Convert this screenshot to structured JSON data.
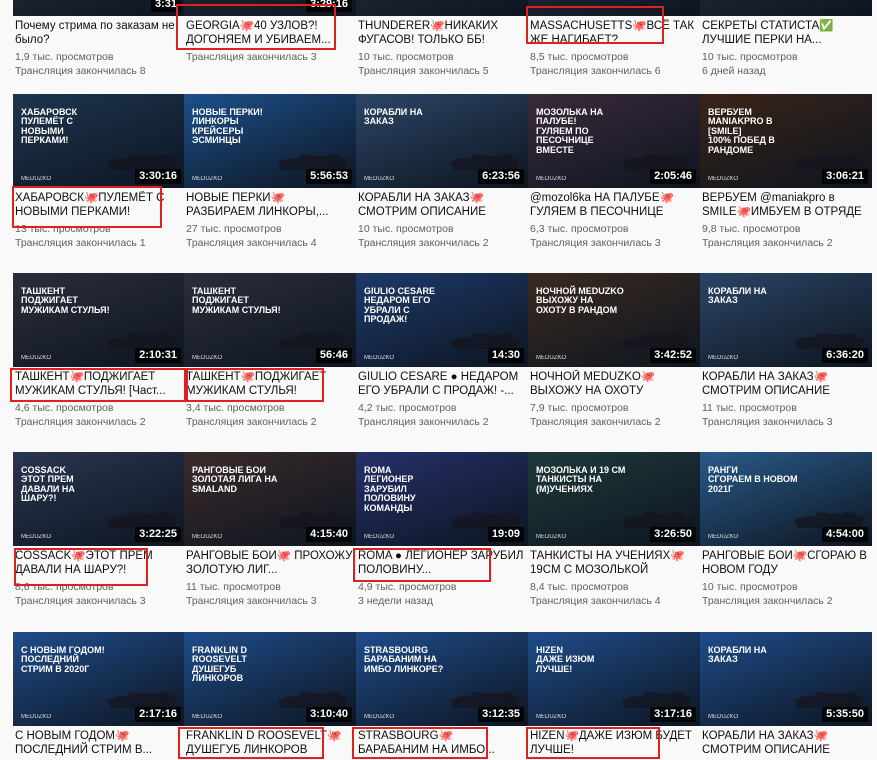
{
  "colors": {
    "highlight": "#e02020",
    "meta_text": "#606060",
    "duration_bg": "#000000"
  },
  "rows": [
    [
      {
        "title": "Почему стрима по заказам не было?",
        "views": "1,9 тыс. просмотров",
        "date": "Трансляция закончилась 8",
        "duration": "",
        "thumb_text": "",
        "thumb_color": "#2a3040"
      },
      {
        "title": "GEORGIA🐙40 УЗЛОВ?! ДОГОНЯЕМ И УБИВАЕМ...",
        "views": "",
        "date": "Трансляция закончилась 3",
        "duration": "",
        "thumb_text": "",
        "thumb_color": "#2a3040"
      },
      {
        "title": "THUNDERER🐙НИКАКИХ ФУГАСОВ! ТОЛЬКО ББ!",
        "views": "10 тыс. просмотров",
        "date": "Трансляция закончилась 5",
        "duration": "",
        "thumb_text": "",
        "thumb_color": "#2a3040"
      },
      {
        "title": "MASSACHUSETTS🐙ВСЁ ТАК ЖЕ НАГИБАЕТ?",
        "views": "8,5 тыс. просмотров",
        "date": "Трансляция закончилась 6",
        "duration": "",
        "thumb_text": "",
        "thumb_color": "#2a3040"
      },
      {
        "title": "СЕКРЕТЫ СТАТИСТА✅ ЛУЧШИЕ ПЕРКИ НА...",
        "views": "10 тыс. просмотров",
        "date": "6 дней назад",
        "duration": "",
        "thumb_text": "",
        "thumb_color": "#2a3040"
      }
    ],
    [
      {
        "title": "ХАБАРОВСК🐙ПУЛЕМЁТ С НОВЫМИ ПЕРКАМИ!",
        "views": "13 тыс. просмотров",
        "date": "Трансляция закончилась 1",
        "duration": "3:30:16",
        "thumb_text": "ХАБАРОВСК\nПУЛЕМЁТ С НОВЫМИ ПЕРКАМИ!",
        "thumb_color": "#1d3550"
      },
      {
        "title": "НОВЫЕ ПЕРКИ🐙 РАЗБИРАЕМ ЛИНКОРЫ,...",
        "views": "27 тыс. просмотров",
        "date": "Трансляция закончилась 4",
        "duration": "5:56:53",
        "thumb_text": "НОВЫЕ ПЕРКИ!\nЛИНКОРЫ КРЕЙСЕРЫ ЭСМИНЦЫ",
        "thumb_color": "#1c4f8a"
      },
      {
        "title": "КОРАБЛИ НА ЗАКАЗ🐙 СМОТРИМ ОПИСАНИЕ",
        "views": "10 тыс. просмотров",
        "date": "Трансляция закончилась 2",
        "duration": "6:23:56",
        "thumb_text": "КОРАБЛИ НА ЗАКАЗ",
        "thumb_color": "#2b4565"
      },
      {
        "title": "@mozol6ka НА ПАЛУБЕ🐙 ГУЛЯЕМ В ПЕСОЧНИЦЕ",
        "views": "6,3 тыс. просмотров",
        "date": "Трансляция закончилась 3",
        "duration": "2:05:46",
        "thumb_text": "МОЗОЛЬКА НА ПАЛУБЕ!\nГУЛЯЕМ ПО ПЕСОЧНИЦЕ ВМЕСТЕ",
        "thumb_color": "#3a2a3a"
      },
      {
        "title": "ВЕРБУЕМ @maniakpro в SMILE🐙ИМБУЕМ В ОТРЯДЕ",
        "views": "9,8 тыс. просмотров",
        "date": "Трансляция закончилась 2",
        "duration": "3:06:21",
        "thumb_text": "ВЕРБУЕМ MANIAKPRO В [SMILE]\n100% ПОБЕД В РАНДОМЕ",
        "thumb_color": "#3a2418"
      }
    ],
    [
      {
        "title": "ТАШКЕНТ🐙ПОДЖИГАЕТ МУЖИКАМ СТУЛЬЯ! [Част...",
        "views": "4,6 тыс. просмотров",
        "date": "Трансляция закончилась 2",
        "duration": "2:10:31",
        "thumb_text": "ТАШКЕНТ\nПОДЖИГАЕТ МУЖИКАМ СТУЛЬЯ!",
        "thumb_color": "#2a2e3a"
      },
      {
        "title": "ТАШКЕНТ🐙ПОДЖИГАЕТ МУЖИКАМ СТУЛЬЯ!",
        "views": "3,4 тыс. просмотров",
        "date": "Трансляция закончилась 2",
        "duration": "56:46",
        "thumb_text": "ТАШКЕНТ\nПОДЖИГАЕТ МУЖИКАМ СТУЛЬЯ!",
        "thumb_color": "#2a2e3a"
      },
      {
        "title": "GIULIO CESARE ● НЕДАРОМ ЕГО УБРАЛИ С ПРОДАЖ! -...",
        "views": "4,2 тыс. просмотров",
        "date": "Трансляция закончилась 2",
        "duration": "14:30",
        "thumb_text": "GIULIO CESARE\nНЕДАРОМ ЕГО УБРАЛИ С ПРОДАЖ!",
        "thumb_color": "#1d3a6a"
      },
      {
        "title": "НОЧНОЙ MEDUZKO🐙 ВЫХОЖУ НА ОХОТУ",
        "views": "7,9 тыс. просмотров",
        "date": "Трансляция закончилась 2",
        "duration": "3:42:52",
        "thumb_text": "НОЧНОЙ MEDUZKO\nВЫХОЖУ НА ОХОТУ В РАНДОМ",
        "thumb_color": "#3a2a20"
      },
      {
        "title": "КОРАБЛИ НА ЗАКАЗ🐙 СМОТРИМ ОПИСАНИЕ",
        "views": "11 тыс. просмотров",
        "date": "Трансляция закончилась 3",
        "duration": "6:36:20",
        "thumb_text": "КОРАБЛИ НА ЗАКАЗ",
        "thumb_color": "#2b4565"
      }
    ],
    [
      {
        "title": "COSSACK🐙ЭТОТ ПРЕМ ДАВАЛИ НА ШАРУ?!",
        "views": "8,6 тыс. просмотров",
        "date": "Трансляция закончилась 3",
        "duration": "3:22:25",
        "thumb_text": "COSSACK\nЭТОТ ПРЕМ ДАВАЛИ НА ШАРУ?!",
        "thumb_color": "#2a3550"
      },
      {
        "title": "РАНГОВЫЕ БОИ🐙 ПРОХОЖУ ЗОЛОТУЮ ЛИГ...",
        "views": "11 тыс. просмотров",
        "date": "Трансляция закончилась 3",
        "duration": "4:15:40",
        "thumb_text": "РАНГОВЫЕ БОИ\nЗОЛОТАЯ ЛИГА НА SMALAND",
        "thumb_color": "#3a2a2a"
      },
      {
        "title": "ROMA ● ЛЕГИОНЕР ЗАРУБИЛ ПОЛОВИНУ...",
        "views": "4,9 тыс. просмотров",
        "date": "3 недели назад",
        "duration": "19:09",
        "thumb_text": "ROMA\nЛЕГИОНЕР ЗАРУБИЛ ПОЛОВИНУ КОМАНДЫ",
        "thumb_color": "#26306a"
      },
      {
        "title": "ТАНКИСТЫ НА УЧЕНИЯХ🐙 19СМ С МОЗОЛЬКОЙ",
        "views": "8,4 тыс. просмотров",
        "date": "Трансляция закончилась 4",
        "duration": "3:26:50",
        "thumb_text": "МОЗОЛЬКА И 19 СМ\nТАНКИСТЫ НА (М)УЧЕНИЯХ",
        "thumb_color": "#1e3a3a"
      },
      {
        "title": "РАНГОВЫЕ БОИ🐙СГОРАЮ В НОВОМ ГОДУ",
        "views": "10 тыс. просмотров",
        "date": "Трансляция закончилась 2",
        "duration": "4:54:00",
        "thumb_text": "РАНГИ\nСГОРАЕМ В НОВОМ 2021Г",
        "thumb_color": "#2a5a8a"
      }
    ],
    [
      {
        "title": "С НОВЫМ ГОДОМ🐙 ПОСЛЕДНИЙ СТРИМ В...",
        "views": "",
        "date": "",
        "duration": "2:17:16",
        "thumb_text": "С НОВЫМ ГОДОМ!\nПОСЛЕДНИЙ СТРИМ В 2020Г",
        "thumb_color": "#1f4c8a"
      },
      {
        "title": "FRANKLIN D ROOSEVELT🐙 ДУШЕГУБ ЛИНКОРОВ",
        "views": "",
        "date": "",
        "duration": "3:10:40",
        "thumb_text": "FRANKLIN D ROOSEVELT\nДУШЕГУБ ЛИНКОРОВ",
        "thumb_color": "#1f4c8a"
      },
      {
        "title": "STRASBOURG🐙 БАРАБАНИМ НА ИМБО...",
        "views": "",
        "date": "",
        "duration": "3:12:35",
        "thumb_text": "STRASBOURG\nБАРАБАНИМ НА ИМБО ЛИНКОРЕ?",
        "thumb_color": "#1f4c8a"
      },
      {
        "title": "HIZEN🐙ДАЖЕ ИЗЮМ БУДЕТ ЛУЧШЕ!",
        "views": "",
        "date": "",
        "duration": "3:17:16",
        "thumb_text": "HIZEN\nДАЖЕ ИЗЮМ ЛУЧШЕ!",
        "thumb_color": "#1f4c8a"
      },
      {
        "title": "КОРАБЛИ НА ЗАКАЗ🐙 СМОТРИМ ОПИСАНИЕ",
        "views": "",
        "date": "",
        "duration": "5:35:50",
        "thumb_text": "КОРАБЛИ НА ЗАКАЗ",
        "thumb_color": "#1f4c8a"
      }
    ]
  ],
  "partial_top_durations": [
    "3:31",
    "3:29:16",
    "",
    "",
    ""
  ],
  "thumb_logo": "MEDUZKO"
}
